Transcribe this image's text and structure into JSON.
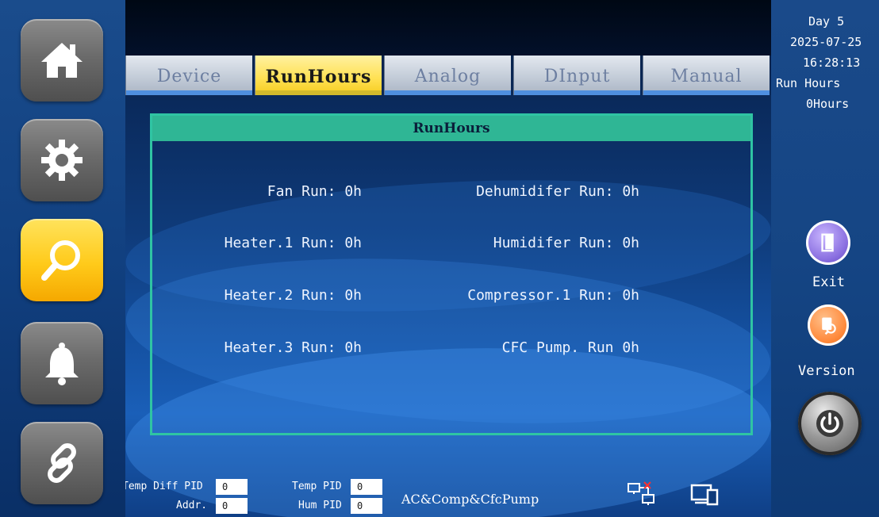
{
  "sidebar": {
    "items": [
      {
        "name": "home",
        "icon": "home-icon",
        "active": false
      },
      {
        "name": "settings",
        "icon": "gear-icon",
        "active": false
      },
      {
        "name": "search",
        "icon": "search-icon",
        "active": true
      },
      {
        "name": "alarm",
        "icon": "bell-icon",
        "active": false
      },
      {
        "name": "link",
        "icon": "link-icon",
        "active": false
      }
    ]
  },
  "tabs": [
    {
      "label": "Device",
      "active": false
    },
    {
      "label": "RunHours",
      "active": true
    },
    {
      "label": "Analog",
      "active": false
    },
    {
      "label": "DInput",
      "active": false
    },
    {
      "label": "Manual",
      "active": false
    }
  ],
  "panel": {
    "title": "RunHours",
    "left_items": [
      "Fan Run: 0h",
      "Heater.1 Run: 0h",
      "Heater.2 Run: 0h",
      "Heater.3 Run: 0h"
    ],
    "right_items": [
      "Dehumidifer Run: 0h",
      "Humidifer Run: 0h",
      "Compressor.1 Run: 0h",
      "CFC Pump. Run 0h"
    ]
  },
  "status": {
    "temp_diff_pid_label": "Temp Diff PID",
    "temp_diff_pid_value": "0",
    "temp_pid_label": "Temp PID",
    "temp_pid_value": "0",
    "addr_label": "Addr.",
    "addr_value": "0",
    "hum_pid_label": "Hum PID",
    "hum_pid_value": "0",
    "mode": "AC&Comp&CfcPump",
    "icons": [
      "network-disconnected-icon",
      "devices-icon"
    ]
  },
  "right_panel": {
    "day": "Day  5",
    "date": "2025-07-25",
    "time": "16:28:13",
    "run_hours_label": "Run Hours",
    "run_hours_value": "0Hours",
    "exit_label": "Exit",
    "version_label": "Version",
    "icons": [
      "exit-icon",
      "version-icon",
      "power-icon"
    ]
  },
  "colors": {
    "accent_teal": "#2fb695",
    "active_yellow": "#ffd633",
    "background_blue": "#0f3b7a"
  }
}
